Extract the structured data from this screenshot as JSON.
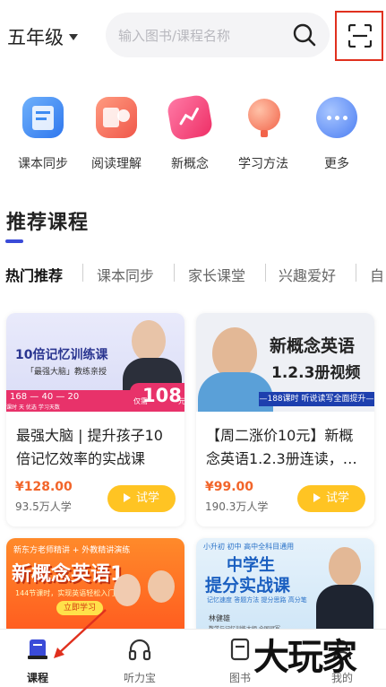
{
  "header": {
    "grade": "五年级",
    "search_placeholder": "输入图书/课程名称"
  },
  "categories": [
    {
      "label": "课本同步",
      "icon": "book-icon",
      "color": "#3d8bf2"
    },
    {
      "label": "阅读理解",
      "icon": "reading-icon",
      "color": "#f26b5b"
    },
    {
      "label": "新概念",
      "icon": "new-concept-icon",
      "color": "#f2477a"
    },
    {
      "label": "学习方法",
      "icon": "balloon-icon",
      "color": "#f58a6a"
    },
    {
      "label": "更多",
      "icon": "more-icon",
      "color": "#5b8cf5"
    }
  ],
  "section": {
    "title": "推荐课程",
    "tabs": [
      "热门推荐",
      "课本同步",
      "家长课堂",
      "兴趣爱好",
      "自"
    ]
  },
  "cards": [
    {
      "title": "最强大脑 | 提升孩子10倍记忆效率的实战课",
      "price": "¥128.00",
      "learners": "93.5万人学",
      "try_label": "试学",
      "cover": {
        "headline": "10倍记忆训练课",
        "sub": "「最强大脑」教练亲授",
        "stats": [
          "168",
          "40",
          "20"
        ],
        "stats_labels": [
          "课时",
          "天",
          "优选",
          "学习天数"
        ],
        "price_tag": "108",
        "price_prefix": "仅需",
        "price_suffix": "元"
      }
    },
    {
      "title": "【周二涨价10元】新概念英语1.2.3册连读，…",
      "price": "¥99.00",
      "learners": "190.3万人学",
      "try_label": "试学",
      "cover": {
        "headline": "新概念英语",
        "sub": "1.2.3册视频",
        "banner": "—188课时 听说读写全面提升—"
      }
    },
    {
      "cover": {
        "top": "新东方老师精讲 + 外教精讲演练",
        "headline": "新概念英语1",
        "sub": "144节课时，实现英语轻松入门",
        "badge": "立即学习"
      }
    },
    {
      "cover": {
        "tags": [
          "小升初",
          "初中",
          "高中全科目通用"
        ],
        "headline": "中学生",
        "headline2": "提分实战课",
        "pills": [
          "记忆速度",
          "答题方法",
          "提分思路",
          "高分笔记"
        ],
        "teacher": "林健雄",
        "teacher_title": "数学与记忆训练大师 全国冠军"
      }
    }
  ],
  "bottom_nav": [
    {
      "label": "课程",
      "icon": "course-icon",
      "active": true
    },
    {
      "label": "听力宝",
      "icon": "headphones-icon",
      "active": false
    },
    {
      "label": "图书",
      "icon": "book-shelf-icon",
      "active": false
    },
    {
      "label": "我的",
      "icon": "profile-icon",
      "active": false
    }
  ],
  "watermark": "大玩家",
  "colors": {
    "accent": "#3a4bd8",
    "price": "#f2652a",
    "try_button": "#ffc423",
    "highlight_box": "#e0301e"
  }
}
